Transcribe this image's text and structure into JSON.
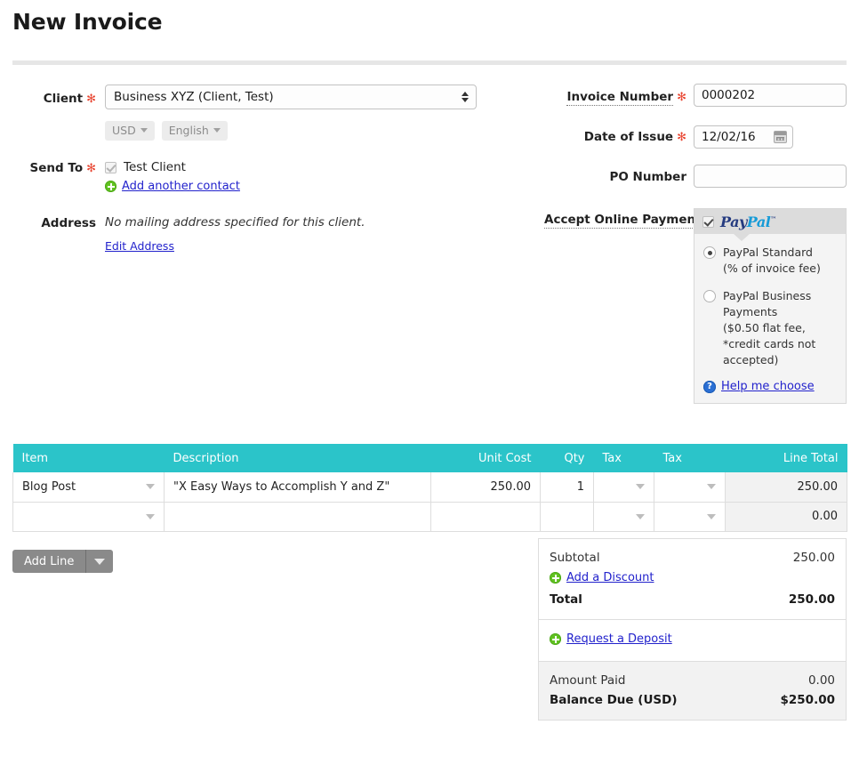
{
  "page": {
    "title": "New Invoice"
  },
  "form": {
    "client": {
      "label": "Client",
      "required_mark": "✻",
      "value": "Business XYZ (Client, Test)",
      "currency_pill": "USD",
      "language_pill": "English"
    },
    "send_to": {
      "label": "Send To",
      "required_mark": "✻",
      "contact": "Test Client",
      "add_contact_link": "Add another contact"
    },
    "address": {
      "label": "Address",
      "value": "No mailing address specified for this client.",
      "edit_link": "Edit Address"
    },
    "invoice_number": {
      "label": "Invoice Number",
      "required_mark": "✻",
      "value": "0000202"
    },
    "date_of_issue": {
      "label": "Date of Issue",
      "required_mark": "✻",
      "value": "12/02/16"
    },
    "po_number": {
      "label": "PO Number",
      "value": "",
      "placeholder": ""
    },
    "accept_online_payments": {
      "label": "Accept Online Payments",
      "provider": "PayPal",
      "provider_pay": "Pay",
      "provider_pal": "Pal",
      "trademark": "®",
      "enabled": true,
      "options": [
        {
          "label": "PayPal Standard",
          "sub": "(% of invoice fee)",
          "selected": true
        },
        {
          "label": "PayPal Business Payments",
          "sub": "($0.50 flat fee, *credit cards not accepted)",
          "selected": false
        }
      ],
      "help_link": "Help me choose",
      "help_icon": "question-mark-icon"
    }
  },
  "line_items": {
    "columns": [
      "Item",
      "Description",
      "Unit Cost",
      "Qty",
      "Tax",
      "Tax",
      "Line Total"
    ],
    "rows": [
      {
        "item": "Blog Post",
        "description": "\"X Easy Ways to Accomplish Y and Z\"",
        "unit_cost": "250.00",
        "qty": "1",
        "tax1": "",
        "tax2": "",
        "line_total": "250.00"
      },
      {
        "item": "",
        "description": "",
        "unit_cost": "",
        "qty": "",
        "tax1": "",
        "tax2": "",
        "line_total": "0.00"
      }
    ],
    "add_line_label": "Add Line"
  },
  "totals": {
    "subtotal_label": "Subtotal",
    "subtotal_value": "250.00",
    "discount_link": "Add a Discount",
    "total_label": "Total",
    "total_value": "250.00",
    "deposit_link": "Request a Deposit",
    "amount_paid_label": "Amount Paid",
    "amount_paid_value": "0.00",
    "balance_due_label": "Balance Due (USD)",
    "balance_due_value": "$250.00"
  },
  "colors": {
    "table_header": "#2bc4c9",
    "required_asterisk": "#e8432f",
    "link": "#2222cc",
    "plus_icon": "#61c221",
    "paypal_dark": "#253b80",
    "paypal_light": "#179bd7",
    "button_gray": "#8a8a8a"
  }
}
